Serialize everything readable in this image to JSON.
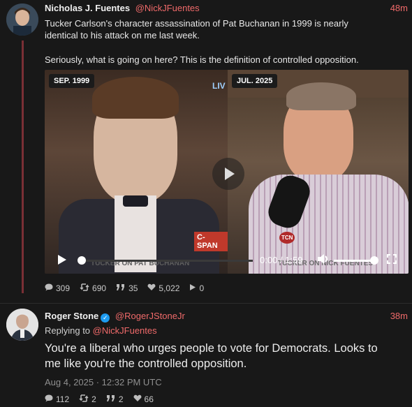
{
  "tweet1": {
    "name": "Nicholas J. Fuentes",
    "handle": "@NickJFuentes",
    "time": "48m",
    "text_line1": "Tucker Carlson's character assassination of Pat Buchanan in 1999 is nearly",
    "text_line2": "identical to his attack on me last week.",
    "text_line3": "Seriously, what is going on here? This is the definition of controlled opposition.",
    "media": {
      "left_tag": "SEP. 1999",
      "right_tag": "JUL. 2025",
      "left_caption": "TUCKER ON PAT BUCHANAN",
      "right_caption": "TUCKER ON NICK FUENTES",
      "cspan_logo": "C-SPAN",
      "live": "LIV",
      "tcn_logo": "TCN",
      "time_display": "0:00 / 1:59",
      "colors": {
        "cspan": "#c0392b"
      }
    },
    "stats": {
      "replies": "309",
      "retweets": "690",
      "quotes": "35",
      "likes": "5,022",
      "views": "0"
    }
  },
  "tweet2": {
    "name": "Roger Stone",
    "handle": "@RogerJStoneJr",
    "time": "38m",
    "replying_label": "Replying to",
    "replying_handle": "@NickJFuentes",
    "text_line1": "You're a liberal who urges people to vote for Democrats. Looks to",
    "text_line2": "me like you're the controlled opposition.",
    "date": "Aug 4, 2025 · 12:32 PM UTC",
    "stats": {
      "replies": "112",
      "retweets": "2",
      "quotes": "2",
      "likes": "66"
    }
  },
  "icons": {
    "reply": "comment-icon",
    "retweet": "retweet-icon",
    "quote": "quote-icon",
    "like": "heart-icon",
    "views": "play-icon"
  },
  "colors": {
    "accent": "#f06a6a",
    "background": "#181818",
    "verified": "#1d9bf0"
  }
}
